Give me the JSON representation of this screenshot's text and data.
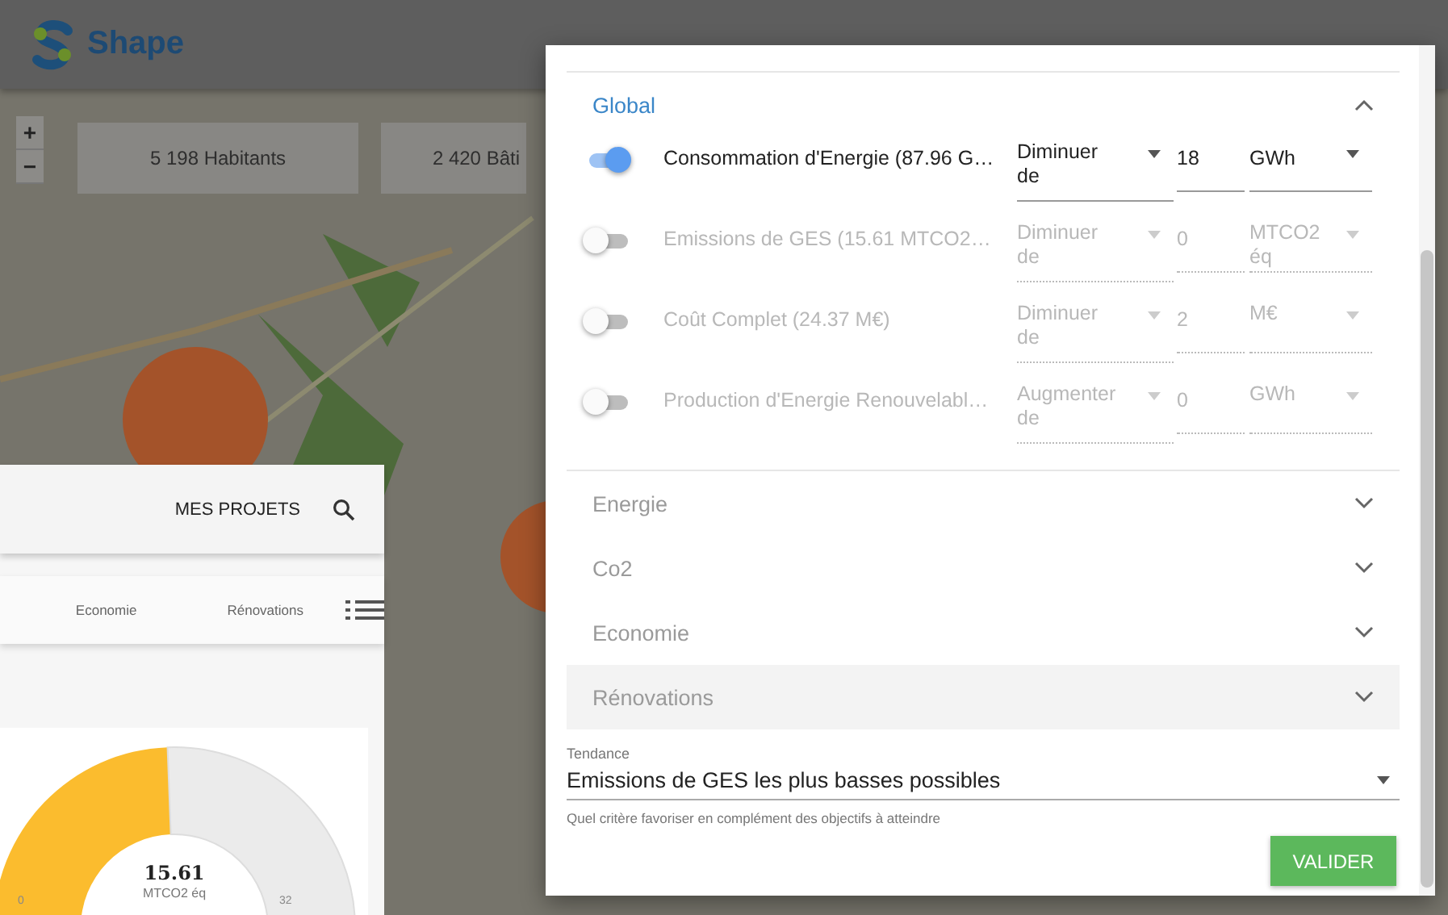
{
  "app": {
    "logo_text": "Shape"
  },
  "map": {
    "zoom_in": "+",
    "zoom_out": "−",
    "stats": [
      "5 198 Habitants",
      "2 420 Bâti"
    ]
  },
  "dialog": {
    "sections": [
      {
        "title": "Global",
        "expanded": true,
        "hovered": false,
        "objectives": [
          {
            "label": "Consommation d'Energie (87.96 G…",
            "on": true,
            "direction": "Diminuer de",
            "value": "18",
            "unit": "GWh"
          },
          {
            "label": "Emissions de GES (15.61 MTCO2…",
            "on": false,
            "direction": "Diminuer de",
            "value": "0",
            "unit": "MTCO2 éq"
          },
          {
            "label": "Coût Complet (24.37 M€)",
            "on": false,
            "direction": "Diminuer de",
            "value": "2",
            "unit": "M€"
          },
          {
            "label": "Production d'Energie Renouvelabl…",
            "on": false,
            "direction": "Augmenter de",
            "value": "0",
            "unit": "GWh"
          }
        ]
      },
      {
        "title": "Energie",
        "expanded": false,
        "hovered": false
      },
      {
        "title": "Co2",
        "expanded": false,
        "hovered": false
      },
      {
        "title": "Economie",
        "expanded": false,
        "hovered": false
      },
      {
        "title": "Rénovations",
        "expanded": false,
        "hovered": true
      }
    ],
    "tendance": {
      "label": "Tendance",
      "value": "Emissions de GES les plus basses possibles",
      "hint": "Quel critère favoriser en complément des objectifs à atteindre"
    },
    "submit": "VALIDER"
  },
  "side_panel": {
    "nav_link": "MES PROJETS",
    "tabs": [
      "Economie",
      "Rénovations"
    ],
    "gauge": {
      "value": "15.61",
      "unit": "MTCO2 éq",
      "min": "0",
      "max": "32",
      "level": 0.488
    }
  }
}
